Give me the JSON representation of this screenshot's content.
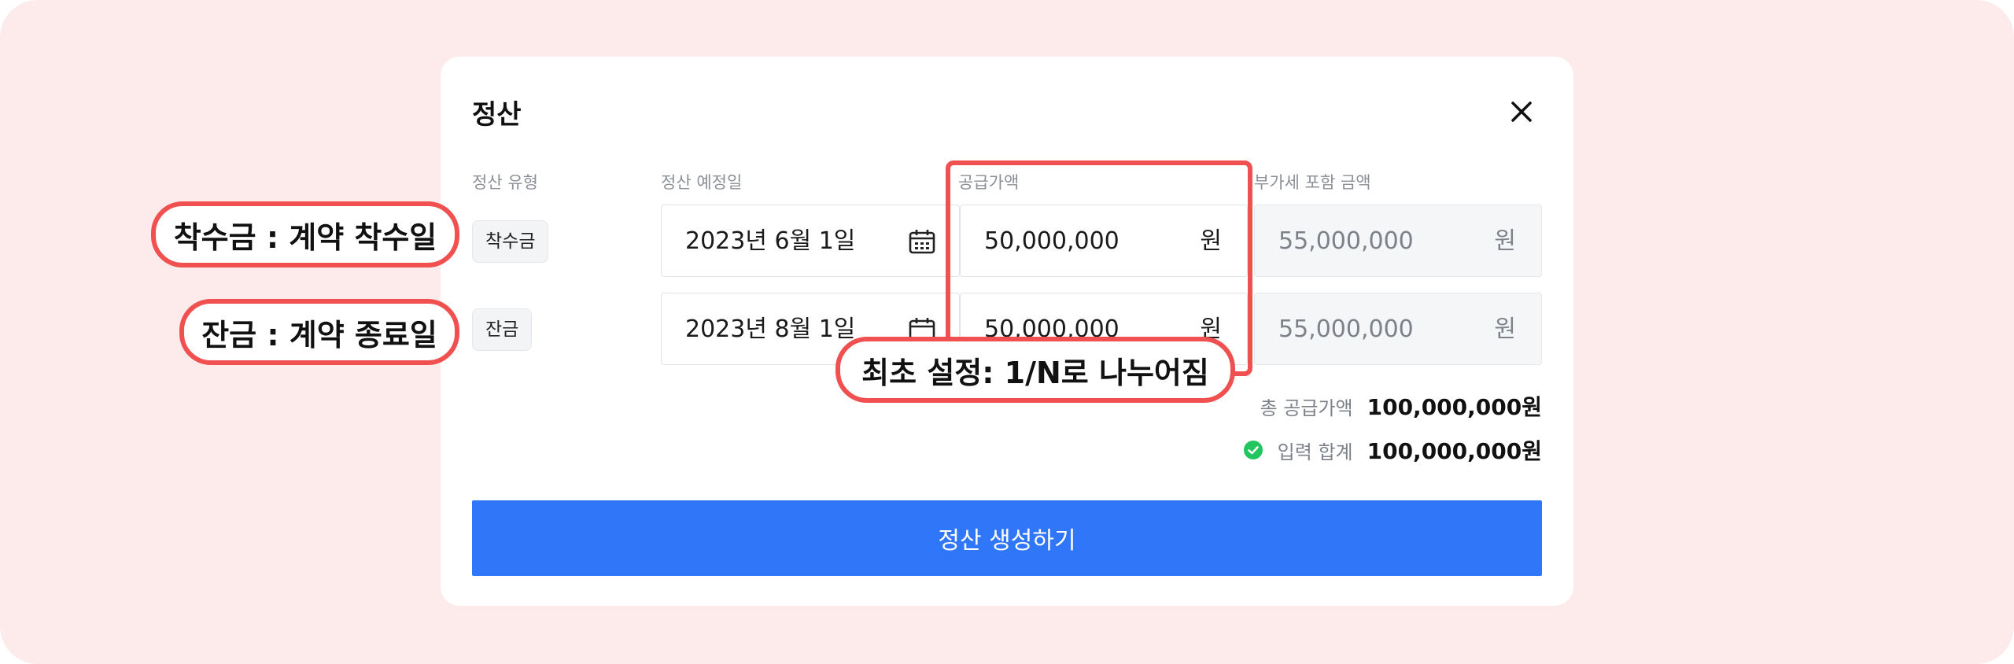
{
  "modal": {
    "title": "정산",
    "headers": {
      "type": "정산 유형",
      "date": "정산 예정일",
      "supply": "공급가액",
      "vat": "부가세 포함 금액"
    },
    "rows": [
      {
        "type": "착수금",
        "date": "2023년 6월 1일",
        "supply": "50,000,000",
        "supply_unit": "원",
        "vat": "55,000,000",
        "vat_unit": "원"
      },
      {
        "type": "잔금",
        "date": "2023년 8월 1일",
        "supply": "50,000,000",
        "supply_unit": "원",
        "vat": "55,000,000",
        "vat_unit": "원"
      }
    ],
    "summary": {
      "total_label": "총 공급가액",
      "total_value": "100,000,000원",
      "input_label": "입력 합계",
      "input_value": "100,000,000원"
    },
    "submit_label": "정산 생성하기"
  },
  "annotations": {
    "row1": "착수금 : 계약 착수일",
    "row2": "잔금 : 계약 종료일",
    "supply_note": "최초 설정: 1/N로 나누어짐"
  },
  "icons": {
    "close": "close-icon",
    "calendar": "calendar-icon",
    "check": "check-circle-icon"
  },
  "colors": {
    "accent": "#2f77f8",
    "annotation": "#f05050",
    "check": "#22c55e",
    "background": "#fdeaea"
  }
}
